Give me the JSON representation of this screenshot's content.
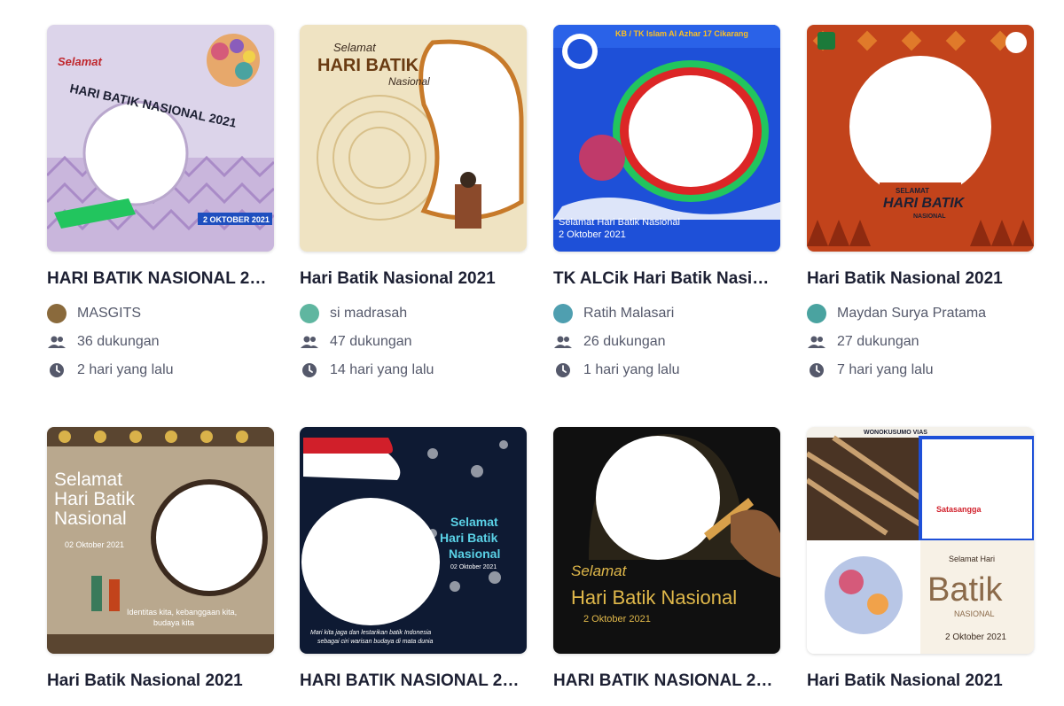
{
  "campaigns": [
    {
      "title": "HARI BATIK NASIONAL 2…",
      "author": "MASGITS",
      "supporters": "36 dukungan",
      "time": "2 hari yang lalu",
      "avatar_color": "#8a6a3c",
      "thumb": {
        "greeting": "Selamat",
        "heading": "HARI BATIK NASIONAL 2021",
        "date": "2 OKTOBER 2021"
      }
    },
    {
      "title": "Hari Batik Nasional 2021",
      "author": "si madrasah",
      "supporters": "47 dukungan",
      "time": "14 hari yang lalu",
      "avatar_color": "#5fb6a0",
      "thumb": {
        "greeting": "Selamat",
        "heading": "HARI BATIK",
        "sub": "Nasional"
      }
    },
    {
      "title": "TK ALCik Hari Batik Nasio…",
      "author": "Ratih Malasari",
      "supporters": "26 dukungan",
      "time": "1 hari yang lalu",
      "avatar_color": "#4f9fb0",
      "thumb": {
        "header": "KB / TK Islam Al Azhar 17 Cikarang",
        "footer1": "Selamat Hari Batik Nasional",
        "footer2": "2 Oktober 2021"
      }
    },
    {
      "title": "Hari Batik Nasional 2021",
      "author": "Maydan Surya Pratama",
      "supporters": "27 dukungan",
      "time": "7 hari yang lalu",
      "avatar_color": "#4aa3a0",
      "thumb": {
        "greeting": "SELAMAT",
        "heading": "HARI BATIK",
        "sub": "NASIONAL"
      }
    },
    {
      "title": "Hari Batik Nasional 2021",
      "thumb": {
        "line1": "Selamat",
        "line2": "Hari Batik",
        "line3": "Nasional",
        "date": "02 Oktober 2021",
        "caption1": "Identitas kita, kebanggaan kita,",
        "caption2": "budaya kita"
      }
    },
    {
      "title": "HARI BATIK NASIONAL 2…",
      "thumb": {
        "line1": "Selamat",
        "line2": "Hari Batik",
        "line3": "Nasional",
        "date": "02 Oktober 2021",
        "caption1": "Mari kita jaga dan lestarikan batik Indonesia",
        "caption2": "sebagai ciri warisan budaya di mata dunia"
      }
    },
    {
      "title": "HARI BATIK NASIONAL 2…",
      "thumb": {
        "line1": "Selamat",
        "line2": "Hari Batik Nasional",
        "date": "2 Oktober 2021"
      }
    },
    {
      "title": "Hari Batik Nasional 2021",
      "thumb": {
        "top": "WONOKUSUMO VIAS",
        "brand": "Satasangga",
        "line1": "Selamat Hari",
        "line2": "Batik",
        "line3": "NASIONAL",
        "date": "2 Oktober 2021"
      }
    }
  ]
}
